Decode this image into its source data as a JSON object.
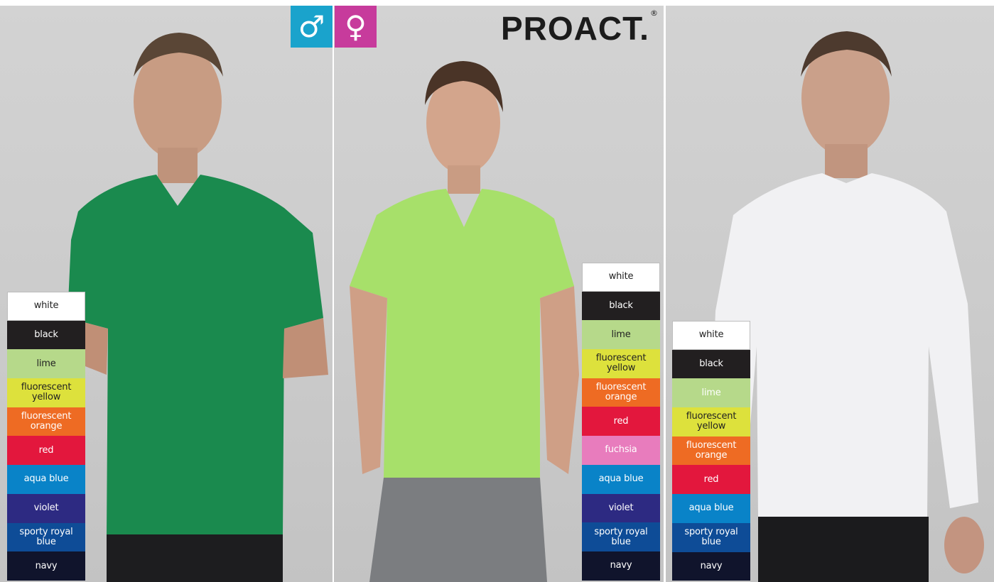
{
  "brand": {
    "name": "PROACT.",
    "registered_mark": "®"
  },
  "gender_badges": {
    "male": {
      "symbol": "♂",
      "color": "#1aa3cc"
    },
    "female": {
      "symbol": "♀",
      "color": "#c73b9c"
    }
  },
  "products": [
    {
      "shirt_color": "#1a8a4e",
      "colors": [
        {
          "label": "white",
          "bg": "#ffffff",
          "fg": "#222222"
        },
        {
          "label": "black",
          "bg": "#221f20",
          "fg": "#ffffff"
        },
        {
          "label": "lime",
          "bg": "#b6d98a",
          "fg": "#222222"
        },
        {
          "label": "fluorescent yellow",
          "bg": "#dde13c",
          "fg": "#222222"
        },
        {
          "label": "fluorescent orange",
          "bg": "#ee6b23",
          "fg": "#ffffff"
        },
        {
          "label": "red",
          "bg": "#e3173d",
          "fg": "#ffffff"
        },
        {
          "label": "aqua blue",
          "bg": "#0983c8",
          "fg": "#ffffff"
        },
        {
          "label": "violet",
          "bg": "#2d2a82",
          "fg": "#ffffff"
        },
        {
          "label": "sporty royal blue",
          "bg": "#0e4c97",
          "fg": "#ffffff"
        },
        {
          "label": "navy",
          "bg": "#10142c",
          "fg": "#ffffff"
        }
      ]
    },
    {
      "shirt_color": "#a7e06a",
      "colors": [
        {
          "label": "white",
          "bg": "#ffffff",
          "fg": "#222222"
        },
        {
          "label": "black",
          "bg": "#221f20",
          "fg": "#ffffff"
        },
        {
          "label": "lime",
          "bg": "#b6d98a",
          "fg": "#222222"
        },
        {
          "label": "fluorescent yellow",
          "bg": "#dde13c",
          "fg": "#222222"
        },
        {
          "label": "fluorescent orange",
          "bg": "#ee6b23",
          "fg": "#ffffff"
        },
        {
          "label": "red",
          "bg": "#e3173d",
          "fg": "#ffffff"
        },
        {
          "label": "fuchsia",
          "bg": "#e87cbd",
          "fg": "#ffffff"
        },
        {
          "label": "aqua blue",
          "bg": "#0983c8",
          "fg": "#ffffff"
        },
        {
          "label": "violet",
          "bg": "#2d2a82",
          "fg": "#ffffff"
        },
        {
          "label": "sporty royal blue",
          "bg": "#0e4c97",
          "fg": "#ffffff"
        },
        {
          "label": "navy",
          "bg": "#10142c",
          "fg": "#ffffff"
        }
      ]
    },
    {
      "shirt_color": "#f1f1f3",
      "colors": [
        {
          "label": "white",
          "bg": "#ffffff",
          "fg": "#222222"
        },
        {
          "label": "black",
          "bg": "#221f20",
          "fg": "#ffffff"
        },
        {
          "label": "lime",
          "bg": "#b6d98a",
          "fg": "#ffffff"
        },
        {
          "label": "fluorescent yellow",
          "bg": "#dde13c",
          "fg": "#222222"
        },
        {
          "label": "fluorescent orange",
          "bg": "#ee6b23",
          "fg": "#ffffff"
        },
        {
          "label": "red",
          "bg": "#e3173d",
          "fg": "#ffffff"
        },
        {
          "label": "aqua blue",
          "bg": "#0983c8",
          "fg": "#ffffff"
        },
        {
          "label": "sporty royal blue",
          "bg": "#0e4c97",
          "fg": "#ffffff"
        },
        {
          "label": "navy",
          "bg": "#10142c",
          "fg": "#ffffff"
        }
      ]
    }
  ]
}
